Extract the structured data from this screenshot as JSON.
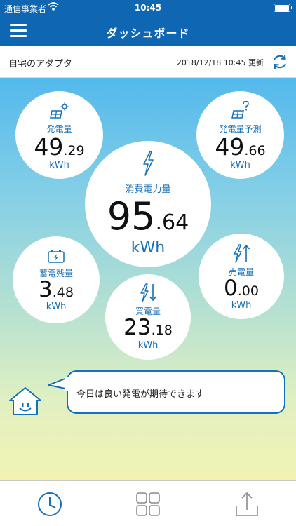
{
  "status": {
    "carrier": "通信事業者",
    "time": "10:45"
  },
  "nav": {
    "title": "ダッシュボード",
    "menu_icon": "hamburger-menu-icon"
  },
  "info": {
    "adapter_name": "自宅のアダプタ",
    "updated": "2018/12/18 10:45 更新",
    "refresh_icon": "refresh-icon"
  },
  "tiles": {
    "generation": {
      "label": "発電量",
      "int": "49",
      "dec": ".29",
      "unit": "kWh",
      "icon": "solar-panel-sun-icon"
    },
    "forecast": {
      "label": "発電量予測",
      "int": "49",
      "dec": ".66",
      "unit": "kWh",
      "icon": "solar-panel-question-icon"
    },
    "consumption": {
      "label": "消費電力量",
      "int": "95",
      "dec": ".64",
      "unit": "kWh",
      "icon": "lightning-icon"
    },
    "storage": {
      "label": "蓄電残量",
      "int": "3",
      "dec": ".48",
      "unit": "kWh",
      "icon": "battery-icon"
    },
    "sell": {
      "label": "売電量",
      "int": "0",
      "dec": ".00",
      "unit": "kWh",
      "icon": "lightning-up-icon"
    },
    "buy": {
      "label": "買電量",
      "int": "23",
      "dec": ".18",
      "unit": "kWh",
      "icon": "lightning-down-icon"
    }
  },
  "message": {
    "text": "今日は良い発電が期待できます",
    "mascot_icon": "house-mascot-icon"
  },
  "tabbar": {
    "items": [
      {
        "icon": "clock-icon",
        "active": true
      },
      {
        "icon": "grid-icon",
        "active": false
      },
      {
        "icon": "share-icon",
        "active": false
      }
    ]
  },
  "colors": {
    "brand_blue": "#0f66b3",
    "accent_blue": "#1470b8",
    "sky_top": "#53b9ec",
    "sky_bottom": "#f3f3b2"
  }
}
